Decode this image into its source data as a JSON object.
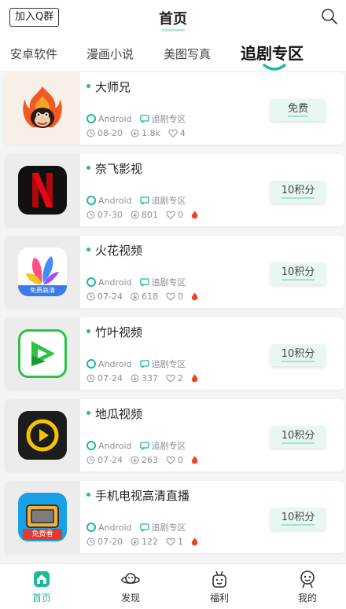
{
  "header": {
    "group_button": "加入Q群",
    "title": "首页",
    "search_icon": "search-icon"
  },
  "tabs": [
    {
      "label": "安卓软件",
      "active": false
    },
    {
      "label": "漫画小说",
      "active": false
    },
    {
      "label": "美图写真",
      "active": false
    },
    {
      "label": "追剧专区",
      "active": true
    }
  ],
  "apps": [
    {
      "name": "大师兄",
      "platform": "Android",
      "category": "追剧专区",
      "date": "08-20",
      "downloads": "1.8k",
      "likes": "4",
      "hot": false,
      "price": "免费",
      "icon": "monkey-flame-icon"
    },
    {
      "name": "奈飞影视",
      "platform": "Android",
      "category": "追剧专区",
      "date": "07-30",
      "downloads": "801",
      "likes": "0",
      "hot": true,
      "price": "10积分",
      "icon": "netflix-n-icon"
    },
    {
      "name": "火花视频",
      "platform": "Android",
      "category": "追剧专区",
      "date": "07-24",
      "downloads": "618",
      "likes": "0",
      "hot": true,
      "price": "10积分",
      "icon": "spark-video-icon",
      "icon_badge": "免费高清"
    },
    {
      "name": "竹叶视频",
      "platform": "Android",
      "category": "追剧专区",
      "date": "07-24",
      "downloads": "337",
      "likes": "2",
      "hot": true,
      "price": "10积分",
      "icon": "green-play-icon"
    },
    {
      "name": "地瓜视频",
      "platform": "Android",
      "category": "追剧专区",
      "date": "07-24",
      "downloads": "263",
      "likes": "0",
      "hot": true,
      "price": "10积分",
      "icon": "yellow-play-circle-icon"
    },
    {
      "name": "手机电视高清直播",
      "platform": "Android",
      "category": "追剧专区",
      "date": "07-20",
      "downloads": "122",
      "likes": "1",
      "hot": true,
      "price": "10积分",
      "icon": "tv-icon",
      "icon_badge": "免费看"
    }
  ],
  "bottom_nav": [
    {
      "label": "首页",
      "icon": "home-icon",
      "active": true
    },
    {
      "label": "发现",
      "icon": "planet-icon",
      "active": false
    },
    {
      "label": "福利",
      "icon": "gift-face-icon",
      "active": false
    },
    {
      "label": "我的",
      "icon": "user-face-icon",
      "active": false
    }
  ],
  "colors": {
    "accent": "#1fb89a",
    "price_bg": "#e8f7f1",
    "hot": "#e8452c"
  }
}
